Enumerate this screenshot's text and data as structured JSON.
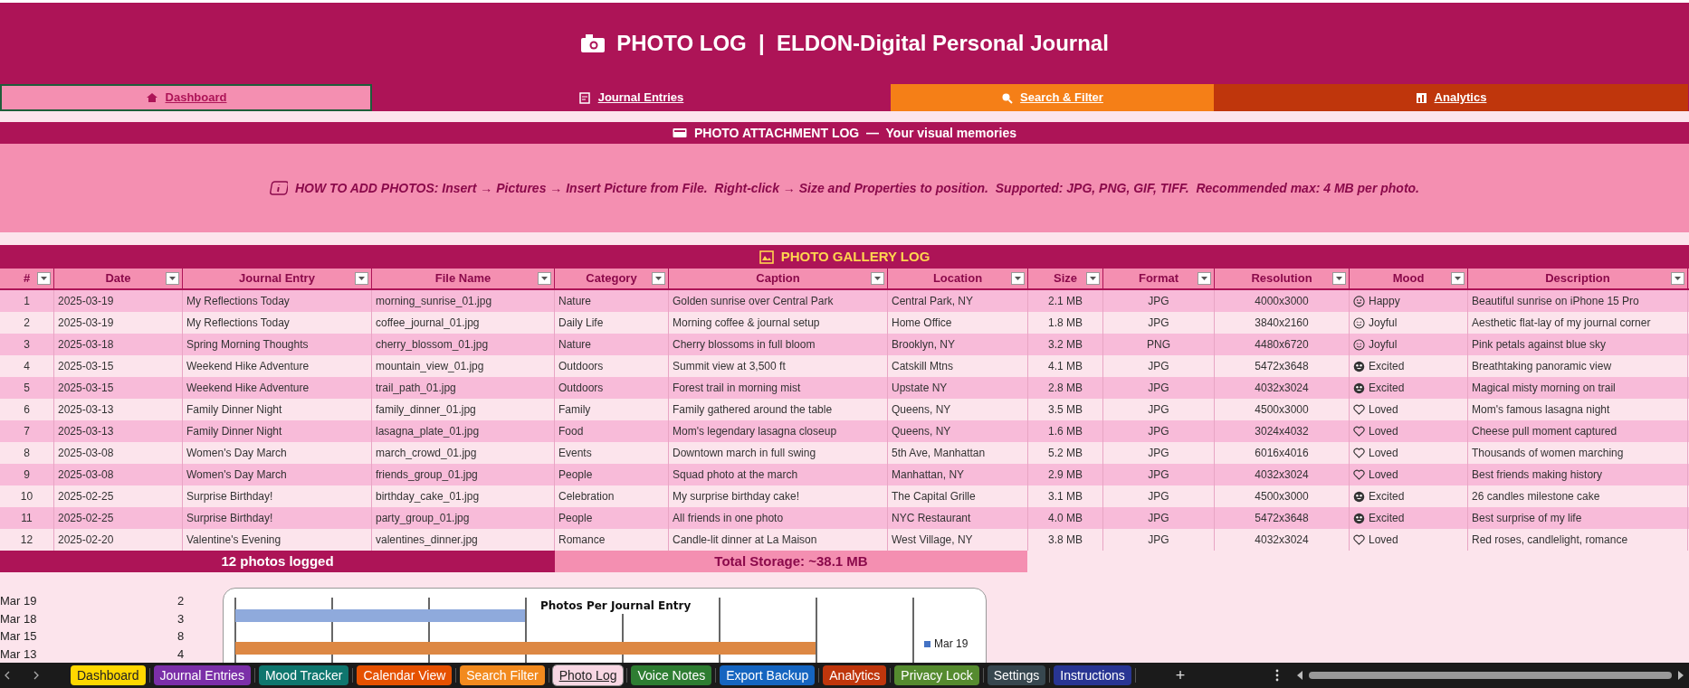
{
  "header": {
    "title": "PHOTO LOG  |  ELDON-Digital Personal Journal"
  },
  "nav": [
    {
      "label": "Dashboard",
      "color": "#f48fb1",
      "selected": true
    },
    {
      "label": "Journal Entries",
      "color": "#ad1457",
      "selected": false
    },
    {
      "label": "Search & Filter",
      "color": "#f57f17",
      "selected": false
    },
    {
      "label": "Analytics",
      "color": "#bf360c",
      "selected": false
    }
  ],
  "section_title": "PHOTO ATTACHMENT LOG  —  Your visual memories",
  "info": "HOW TO ADD PHOTOS: Insert → Pictures → Insert Picture from File.  Right-click → Size and Properties to position.  Supported: JPG, PNG, GIF, TIFF.  Recommended max: 4 MB per photo.",
  "gallery_title": "PHOTO GALLERY LOG",
  "table": {
    "columns": [
      "#",
      "Date",
      "Journal Entry",
      "File Name",
      "Category",
      "Caption",
      "Location",
      "Size",
      "Format",
      "Resolution",
      "Mood",
      "Description"
    ],
    "rows": [
      {
        "cells": [
          "1",
          "2025-03-19",
          "My Reflections Today",
          "morning_sunrise_01.jpg",
          "Nature",
          "Golden sunrise over Central Park",
          "Central Park, NY",
          "2.1 MB",
          "JPG",
          "4000x3000"
        ],
        "mood": {
          "kind": "grin",
          "label": "Happy"
        },
        "description": "Beautiful sunrise on iPhone 15 Pro"
      },
      {
        "cells": [
          "2",
          "2025-03-19",
          "My Reflections Today",
          "coffee_journal_01.jpg",
          "Daily Life",
          "Morning coffee & journal setup",
          "Home Office",
          "1.8 MB",
          "JPG",
          "3840x2160"
        ],
        "mood": {
          "kind": "smile",
          "label": "Joyful"
        },
        "description": "Aesthetic flat-lay of my journal corner"
      },
      {
        "cells": [
          "3",
          "2025-03-18",
          "Spring Morning Thoughts",
          "cherry_blossom_01.jpg",
          "Nature",
          "Cherry blossoms in full bloom",
          "Brooklyn, NY",
          "3.2 MB",
          "PNG",
          "4480x6720"
        ],
        "mood": {
          "kind": "smile",
          "label": "Joyful"
        },
        "description": "Pink petals against blue sky"
      },
      {
        "cells": [
          "4",
          "2025-03-15",
          "Weekend Hike Adventure",
          "mountain_view_01.jpg",
          "Outdoors",
          "Summit view at 3,500 ft",
          "Catskill Mtns",
          "4.1 MB",
          "JPG",
          "5472x3648"
        ],
        "mood": {
          "kind": "star",
          "label": "Excited"
        },
        "description": "Breathtaking panoramic view"
      },
      {
        "cells": [
          "5",
          "2025-03-15",
          "Weekend Hike Adventure",
          "trail_path_01.jpg",
          "Outdoors",
          "Forest trail in morning mist",
          "Upstate NY",
          "2.8 MB",
          "JPG",
          "4032x3024"
        ],
        "mood": {
          "kind": "star",
          "label": "Excited"
        },
        "description": "Magical misty morning on trail"
      },
      {
        "cells": [
          "6",
          "2025-03-13",
          "Family Dinner Night",
          "family_dinner_01.jpg",
          "Family",
          "Family gathered around the table",
          "Queens, NY",
          "3.5 MB",
          "JPG",
          "4500x3000"
        ],
        "mood": {
          "kind": "heart",
          "label": "Loved"
        },
        "description": "Mom's famous lasagna night"
      },
      {
        "cells": [
          "7",
          "2025-03-13",
          "Family Dinner Night",
          "lasagna_plate_01.jpg",
          "Food",
          "Mom's legendary lasagna closeup",
          "Queens, NY",
          "1.6 MB",
          "JPG",
          "3024x4032"
        ],
        "mood": {
          "kind": "heart",
          "label": "Loved"
        },
        "description": "Cheese pull moment captured"
      },
      {
        "cells": [
          "8",
          "2025-03-08",
          "Women's Day March",
          "march_crowd_01.jpg",
          "Events",
          "Downtown march in full swing",
          "5th Ave, Manhattan",
          "5.2 MB",
          "JPG",
          "6016x4016"
        ],
        "mood": {
          "kind": "heart",
          "label": "Loved"
        },
        "description": "Thousands of women marching"
      },
      {
        "cells": [
          "9",
          "2025-03-08",
          "Women's Day March",
          "friends_group_01.jpg",
          "People",
          "Squad photo at the march",
          "Manhattan, NY",
          "2.9 MB",
          "JPG",
          "4032x3024"
        ],
        "mood": {
          "kind": "heart",
          "label": "Loved"
        },
        "description": "Best friends making history"
      },
      {
        "cells": [
          "10",
          "2025-02-25",
          "Surprise Birthday!",
          "birthday_cake_01.jpg",
          "Celebration",
          "My surprise birthday cake!",
          "The Capital Grille",
          "3.1 MB",
          "JPG",
          "4500x3000"
        ],
        "mood": {
          "kind": "star",
          "label": "Excited"
        },
        "description": "26 candles milestone cake"
      },
      {
        "cells": [
          "11",
          "2025-02-25",
          "Surprise Birthday!",
          "party_group_01.jpg",
          "People",
          "All friends in one photo",
          "NYC Restaurant",
          "4.0 MB",
          "JPG",
          "5472x3648"
        ],
        "mood": {
          "kind": "star",
          "label": "Excited"
        },
        "description": "Best surprise of my life"
      },
      {
        "cells": [
          "12",
          "2025-02-20",
          "Valentine's Evening",
          "valentines_dinner.jpg",
          "Romance",
          "Candle-lit dinner at La Maison",
          "West Village, NY",
          "3.8 MB",
          "JPG",
          "4032x3024"
        ],
        "mood": {
          "kind": "heart",
          "label": "Loved"
        },
        "description": "Red roses, candlelight, romance"
      }
    ]
  },
  "summary": {
    "count": "12 photos logged",
    "storage": "Total Storage: ~38.1 MB"
  },
  "chart_source": [
    {
      "label": "Mar 19",
      "value": "2"
    },
    {
      "label": "Mar 18",
      "value": "3"
    },
    {
      "label": "Mar 15",
      "value": "8"
    },
    {
      "label": "Mar 13",
      "value": "4"
    }
  ],
  "chart": {
    "title": "Photos Per Journal Entry",
    "legend": [
      "Mar 19"
    ]
  },
  "sheet_tabs": [
    {
      "label": "Dashboard",
      "color": "#ffd700",
      "selected": false
    },
    {
      "label": "Journal Entries",
      "color": "#7b2fa8",
      "selected": false
    },
    {
      "label": "Mood Tracker",
      "color": "#0f766e",
      "selected": false
    },
    {
      "label": "Calendar View",
      "color": "#e65100",
      "selected": false
    },
    {
      "label": "Search Filter",
      "color": "#f28a1e",
      "selected": false
    },
    {
      "label": "Photo Log",
      "color": "#f8d7e3",
      "selected": true
    },
    {
      "label": "Voice Notes",
      "color": "#2e7d32",
      "selected": false
    },
    {
      "label": "Export Backup",
      "color": "#1565c0",
      "selected": false
    },
    {
      "label": "Analytics",
      "color": "#bf360c",
      "selected": false
    },
    {
      "label": "Privacy Lock",
      "color": "#558b2f",
      "selected": false
    },
    {
      "label": "Settings",
      "color": "#37474f",
      "selected": false
    },
    {
      "label": "Instructions",
      "color": "#283593",
      "selected": false
    }
  ],
  "add_sheet": "+"
}
